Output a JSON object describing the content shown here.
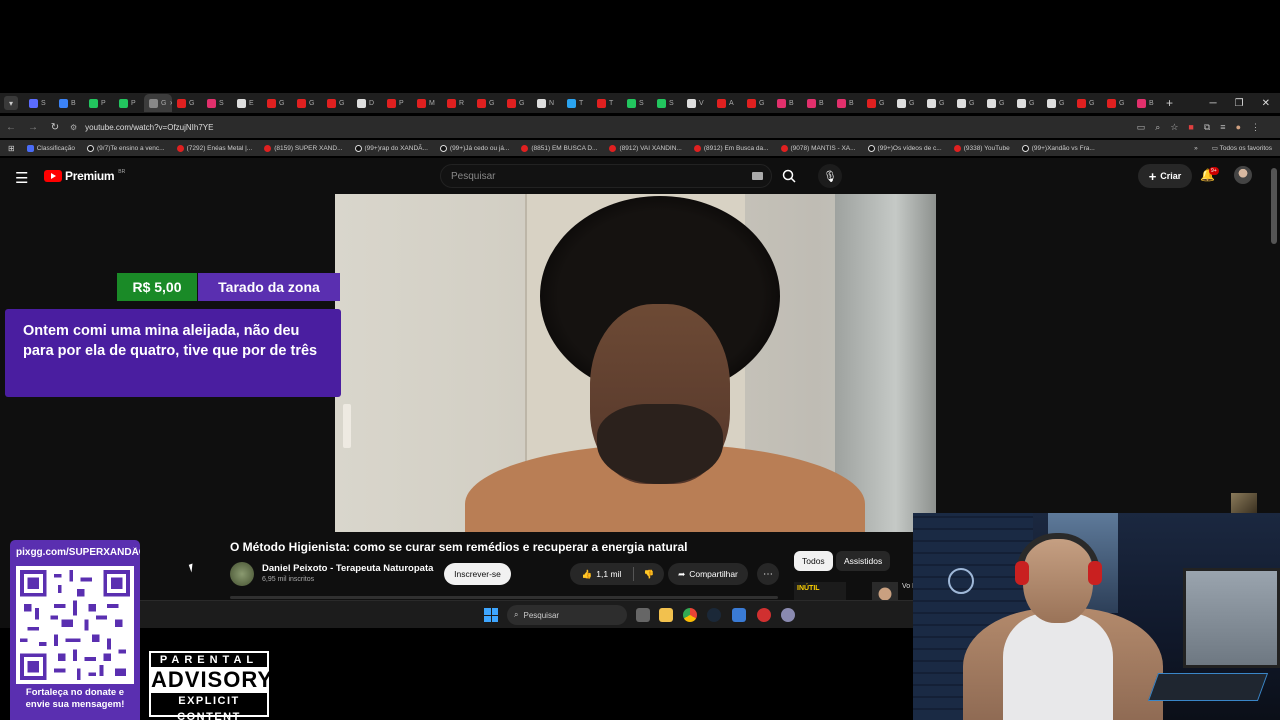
{
  "browser": {
    "tabs": [
      {
        "letter": "S",
        "color": "#5b6cff"
      },
      {
        "letter": "B",
        "color": "#3b82f6"
      },
      {
        "letter": "P",
        "color": "#22c55e"
      },
      {
        "letter": "P",
        "color": "#22c55e"
      },
      {
        "letter": "G",
        "color": "#888888",
        "active": true
      },
      {
        "letter": "G",
        "color": "#e02020"
      },
      {
        "letter": "S",
        "color": "#e1306c"
      },
      {
        "letter": "E",
        "color": "#dddddd"
      },
      {
        "letter": "G",
        "color": "#e02020"
      },
      {
        "letter": "G",
        "color": "#e02020"
      },
      {
        "letter": "G",
        "color": "#e02020"
      },
      {
        "letter": "D",
        "color": "#dddddd"
      },
      {
        "letter": "P",
        "color": "#e02020"
      },
      {
        "letter": "M",
        "color": "#e02020"
      },
      {
        "letter": "R",
        "color": "#e02020"
      },
      {
        "letter": "G",
        "color": "#e02020"
      },
      {
        "letter": "G",
        "color": "#e02020"
      },
      {
        "letter": "N",
        "color": "#dddddd"
      },
      {
        "letter": "T",
        "color": "#2aa3ef"
      },
      {
        "letter": "T",
        "color": "#e02020"
      },
      {
        "letter": "S",
        "color": "#22c55e"
      },
      {
        "letter": "S",
        "color": "#22c55e"
      },
      {
        "letter": "V",
        "color": "#dddddd"
      },
      {
        "letter": "A",
        "color": "#e02020"
      },
      {
        "letter": "G",
        "color": "#e02020"
      },
      {
        "letter": "B",
        "color": "#e1306c"
      },
      {
        "letter": "B",
        "color": "#e1306c"
      },
      {
        "letter": "B",
        "color": "#e1306c"
      },
      {
        "letter": "G",
        "color": "#e02020"
      },
      {
        "letter": "G",
        "color": "#dddddd"
      },
      {
        "letter": "G",
        "color": "#dddddd"
      },
      {
        "letter": "G",
        "color": "#dddddd"
      },
      {
        "letter": "G",
        "color": "#dddddd"
      },
      {
        "letter": "G",
        "color": "#dddddd"
      },
      {
        "letter": "G",
        "color": "#dddddd"
      },
      {
        "letter": "G",
        "color": "#e02020"
      },
      {
        "letter": "G",
        "color": "#e02020"
      },
      {
        "letter": "B",
        "color": "#e1306c"
      }
    ],
    "url": "youtube.com/watch?v=OfzujNIh7YE",
    "bookmarks": [
      {
        "label": "Classificação",
        "icon": "blue"
      },
      {
        "label": "(9/7)Te ensino a venc...",
        "icon": "tiktok"
      },
      {
        "label": "(7292) Enéas Metal |...",
        "icon": "yt"
      },
      {
        "label": "(8159) SUPER XAND...",
        "icon": "yt"
      },
      {
        "label": "(99+)rap do XANDÃ...",
        "icon": "tiktok"
      },
      {
        "label": "(99+)Já cedo ou já...",
        "icon": "tiktok"
      },
      {
        "label": "(8851) EM BUSCA D...",
        "icon": "yt"
      },
      {
        "label": "(8912) VAI XANDIN...",
        "icon": "yt"
      },
      {
        "label": "(8912) Em Busca da...",
        "icon": "yt"
      },
      {
        "label": "(9078) MANTIS - XA...",
        "icon": "yt"
      },
      {
        "label": "(99+)Os vídeos de c...",
        "icon": "tiktok"
      },
      {
        "label": "(9338) YouTube",
        "icon": "yt"
      },
      {
        "label": "(99+)Xandão vs Fra...",
        "icon": "tiktok"
      }
    ],
    "all_bookmarks_label": "Todos os favoritos"
  },
  "youtube": {
    "logo_text": "Premium",
    "logo_region": "BR",
    "search_placeholder": "Pesquisar",
    "create_label": "Criar",
    "notifications_badge": "9+",
    "video_title": "O Método Higienista: como se curar sem remédios e recuperar a energia natural",
    "channel_name": "Daniel Peixoto - Terapeuta Naturopata",
    "channel_subs": "6,95 mil inscritos",
    "subscribe_label": "Inscrever-se",
    "likes": "1,1 mil",
    "share_label": "Compartilhar",
    "chips": [
      "Todos",
      "Assistidos"
    ],
    "rec_thumb_text": "INÚTIL",
    "rec_title_partial": "Vo Pe"
  },
  "taskbar": {
    "search_label": "Pesquisar"
  },
  "overlay": {
    "donation_amount": "R$ 5,00",
    "donor_name": "Tarado da zona",
    "donation_message": "Ontem comi uma mina aleijada, não deu para por ela de quatro, tive que por de três",
    "pix_url": "pixgg.com/SUPERXANDÃO",
    "pix_footer_1": "Fortaleça no donate e",
    "pix_footer_2": "envie sua mensagem!",
    "advisory_top": "PARENTAL",
    "advisory_mid": "ADVISORY",
    "advisory_bottom": "EXPLICIT CONTENT"
  }
}
